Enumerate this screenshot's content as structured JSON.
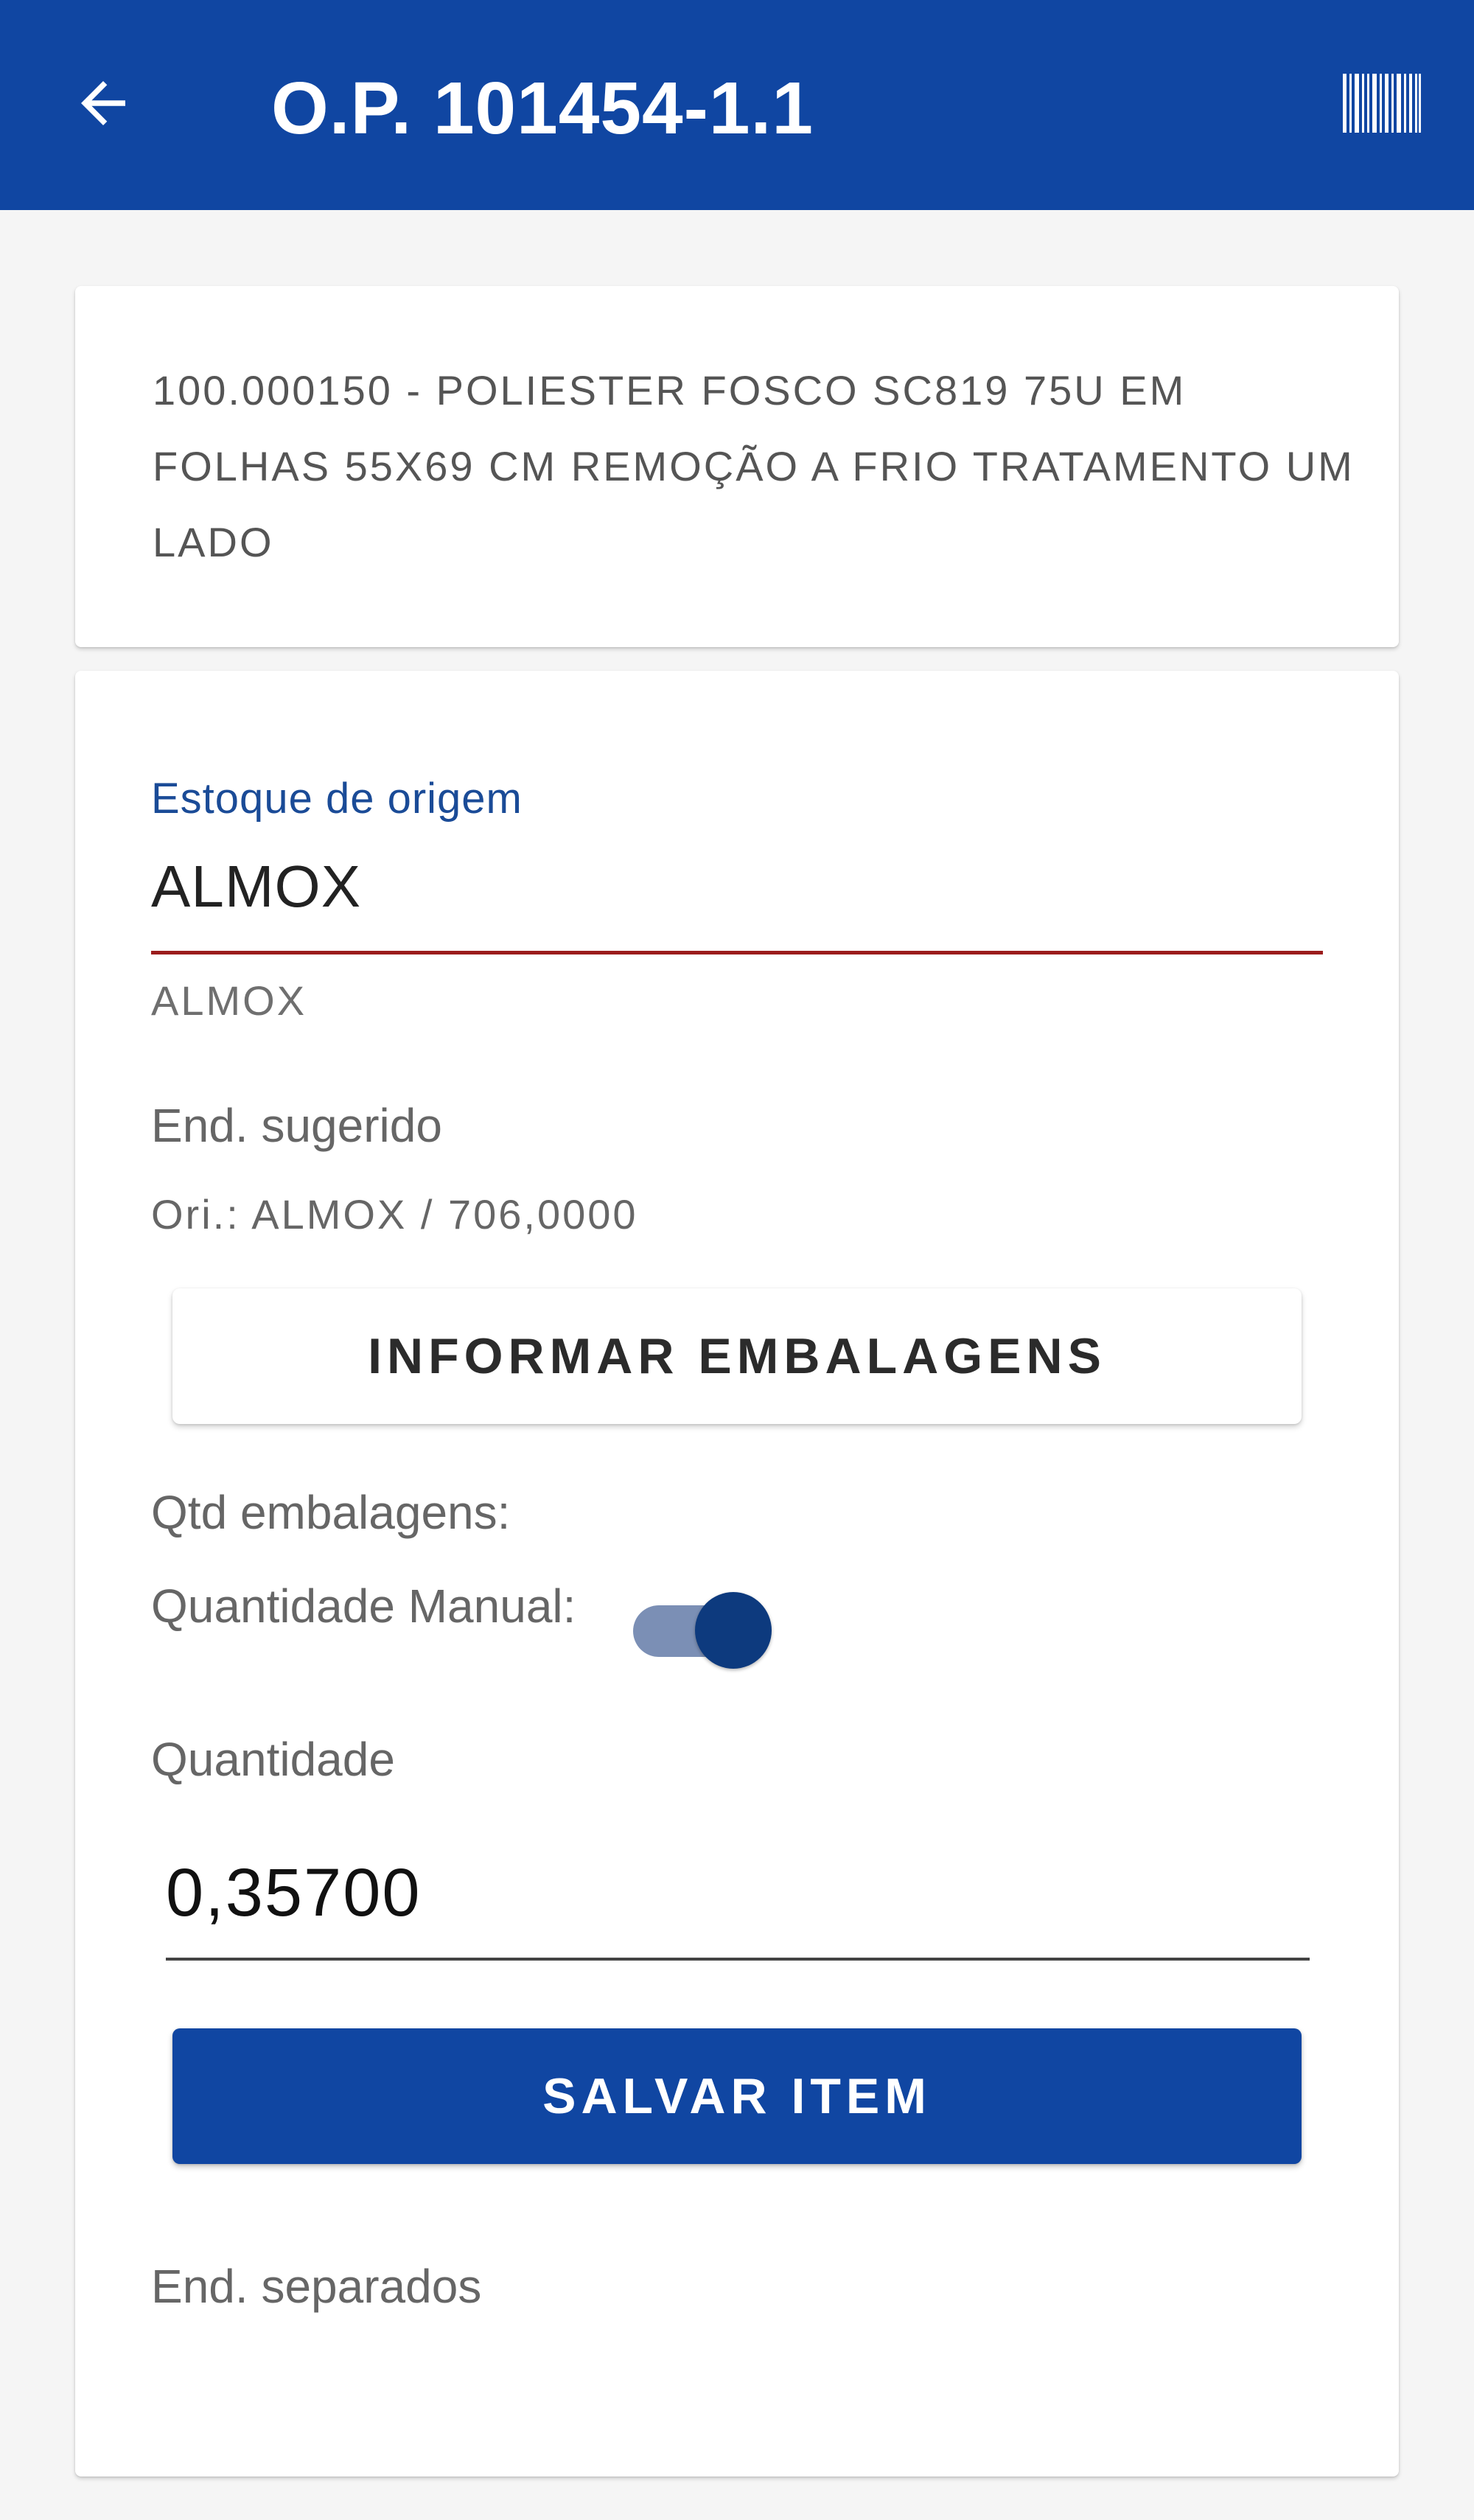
{
  "appbar": {
    "title": "O.P. 101454-1.1",
    "back_icon": "arrow-left-icon",
    "barcode_icon": "barcode-icon",
    "background_color": "#1046a2"
  },
  "item": {
    "description": "100.000150 - POLIESTER FOSCO SC819 75U EM FOLHAS 55X69 CM REMOÇÃO A FRIO TRATAMENTO UM LADO"
  },
  "form": {
    "origin_stock": {
      "label": "Estoque de origem",
      "value": "ALMOX",
      "helper": "ALMOX"
    },
    "suggested_address": {
      "label": "End. sugerido",
      "value": "Ori.: ALMOX / 706,0000"
    },
    "packaging_button_label": "INFORMAR EMBALAGENS",
    "packaging_qty_label": "Qtd embalagens:",
    "manual_qty": {
      "label": "Quantidade Manual:",
      "enabled": true
    },
    "quantity": {
      "label": "Quantidade",
      "value": "0,35700"
    },
    "save_button_label": "SALVAR ITEM",
    "separated_addresses_label": "End. separados"
  },
  "colors": {
    "primary": "#1046a2",
    "accent_underline": "#9b1c1c",
    "toggle_track": "#7b8fb5",
    "toggle_thumb": "#0d3a7e"
  }
}
